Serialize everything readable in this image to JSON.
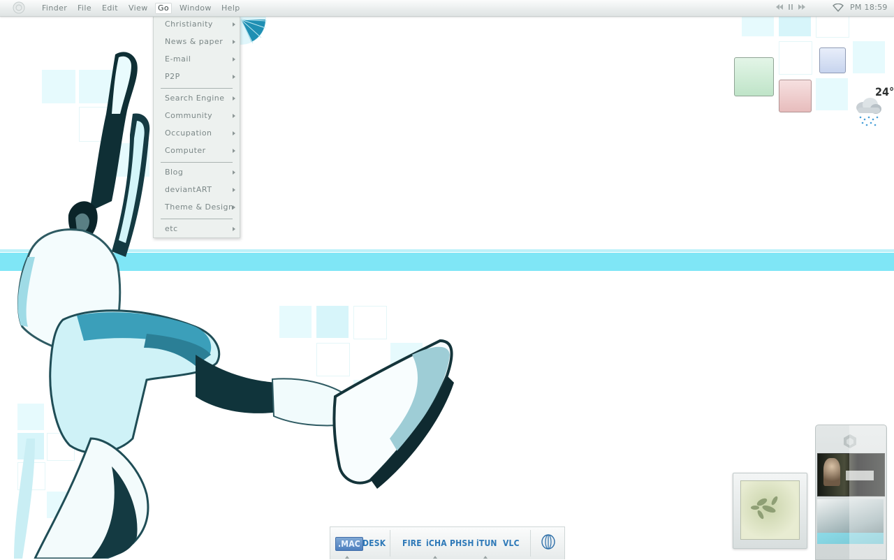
{
  "menubar": {
    "items": [
      "Finder",
      "File",
      "Edit",
      "View",
      "Go",
      "Window",
      "Help"
    ],
    "active_item": "Go",
    "clock": "PM 18:59",
    "media_controls": [
      "rewind-icon",
      "pause-icon",
      "fast-forward-icon"
    ],
    "wifi": "wifi-icon"
  },
  "go_menu": {
    "groups": [
      [
        "Christianity",
        "News & paper",
        "E-mail",
        "P2P"
      ],
      [
        "Search Engine",
        "Community",
        "Occupation",
        "Computer"
      ],
      [
        "Blog",
        "deviantART",
        "Theme & Design"
      ],
      [
        "etc"
      ]
    ]
  },
  "weather": {
    "temperature": "24°",
    "icon": "rain-cloud-icon"
  },
  "dock": {
    "items": [
      ".MAC",
      "DESK",
      "FIRE",
      "iCHA",
      "PHSH",
      "iTUN",
      "VLC"
    ],
    "active": ".MAC"
  },
  "colors": {
    "stripe": "#7fe6f6",
    "accent": "#2e79b8",
    "tile_green": "#c8ebd0",
    "tile_pink": "#efcdce",
    "tile_blue": "#d5e0f3"
  }
}
